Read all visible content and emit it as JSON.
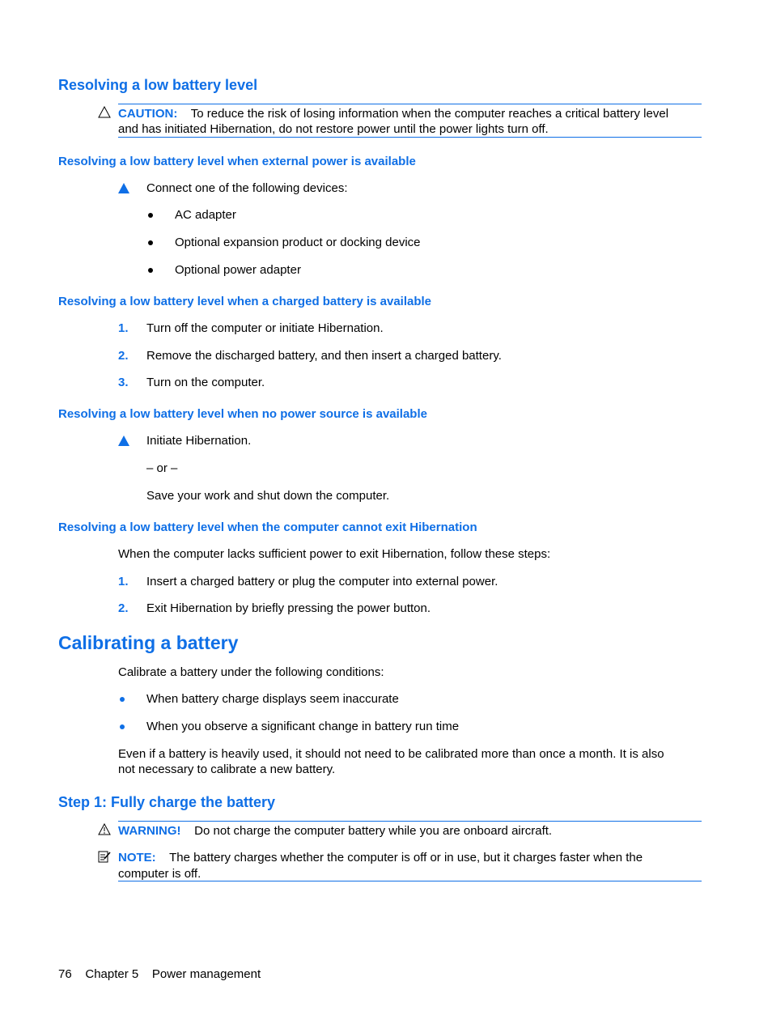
{
  "sections": {
    "low_battery": {
      "title": "Resolving a low battery level",
      "caution_label": "CAUTION:",
      "caution_line1": "To reduce the risk of losing information when the computer reaches a critical battery level",
      "caution_line2": "and has initiated Hibernation, do not restore power until the power lights turn off."
    },
    "external_power": {
      "title": "Resolving a low battery level when external power is available",
      "step": "Connect one of the following devices:",
      "items": [
        "AC adapter",
        "Optional expansion product or docking device",
        "Optional power adapter"
      ]
    },
    "charged_battery": {
      "title": "Resolving a low battery level when a charged battery is available",
      "steps": [
        {
          "n": "1.",
          "text": "Turn off the computer or initiate Hibernation."
        },
        {
          "n": "2.",
          "text": "Remove the discharged battery, and then insert a charged battery."
        },
        {
          "n": "3.",
          "text": "Turn on the computer."
        }
      ]
    },
    "no_power": {
      "title": "Resolving a low battery level when no power source is available",
      "step": "Initiate Hibernation.",
      "or": "– or –",
      "alt": "Save your work and shut down the computer."
    },
    "cannot_exit": {
      "title": "Resolving a low battery level when the computer cannot exit Hibernation",
      "intro": "When the computer lacks sufficient power to exit Hibernation, follow these steps:",
      "steps": [
        {
          "n": "1.",
          "text": "Insert a charged battery or plug the computer into external power."
        },
        {
          "n": "2.",
          "text": "Exit Hibernation by briefly pressing the power button."
        }
      ]
    },
    "calibrating": {
      "title": "Calibrating a battery",
      "intro": "Calibrate a battery under the following conditions:",
      "items": [
        "When battery charge displays seem inaccurate",
        "When you observe a significant change in battery run time"
      ],
      "para_line1": "Even if a battery is heavily used, it should not need to be calibrated more than once a month. It is also",
      "para_line2": "not necessary to calibrate a new battery."
    },
    "step1": {
      "title": "Step 1: Fully charge the battery",
      "warning_label": "WARNING!",
      "warning_text": "Do not charge the computer battery while you are onboard aircraft.",
      "note_label": "NOTE:",
      "note_line1": "The battery charges whether the computer is off or in use, but it charges faster when the",
      "note_line2": "computer is off."
    }
  },
  "footer": {
    "page_number": "76",
    "chapter": "Chapter 5",
    "chapter_title": "Power management"
  }
}
